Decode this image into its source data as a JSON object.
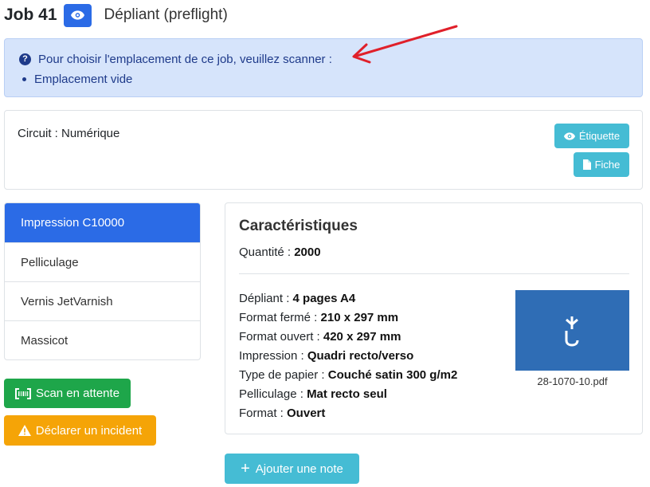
{
  "header": {
    "job_label": "Job 41",
    "subtitle": "Dépliant (preflight)"
  },
  "alert": {
    "message": "Pour choisir l'emplacement de ce job, veuillez scanner :",
    "items": [
      "Emplacement vide"
    ]
  },
  "circuit": {
    "label": "Circuit : Numérique",
    "etiquette_label": "Étiquette",
    "fiche_label": "Fiche"
  },
  "steps": [
    {
      "label": "Impression C10000",
      "active": true
    },
    {
      "label": "Pelliculage",
      "active": false
    },
    {
      "label": "Vernis JetVarnish",
      "active": false
    },
    {
      "label": "Massicot",
      "active": false
    }
  ],
  "actions": {
    "scan_label": "Scan en attente",
    "incident_label": "Déclarer un incident"
  },
  "specs": {
    "title": "Caractéristiques",
    "quantity_label": "Quantité : ",
    "quantity_value": "2000",
    "rows": [
      {
        "label": "Dépliant : ",
        "value": "4 pages A4"
      },
      {
        "label": "Format fermé : ",
        "value": "210 x 297 mm"
      },
      {
        "label": "Format ouvert : ",
        "value": "420 x 297 mm"
      },
      {
        "label": "Impression : ",
        "value": "Quadri recto/verso"
      },
      {
        "label": "Type de papier : ",
        "value": "Couché satin 300 g/m2"
      },
      {
        "label": "Pelliculage : ",
        "value": "Mat recto seul"
      },
      {
        "label": "Format : ",
        "value": "Ouvert"
      }
    ],
    "file_name": "28-1070-10.pdf"
  },
  "note_button_label": "Ajouter une note",
  "colors": {
    "primary": "#2b6be6",
    "info": "#45bcd4",
    "success": "#1ea64a",
    "warning": "#f5a407",
    "alert_bg": "#d6e4fb",
    "annotation_arrow": "#e0202a"
  },
  "icons": [
    "eye-icon",
    "question-circle-icon",
    "file-icon",
    "barcode-icon",
    "warning-triangle-icon",
    "plus-icon"
  ]
}
